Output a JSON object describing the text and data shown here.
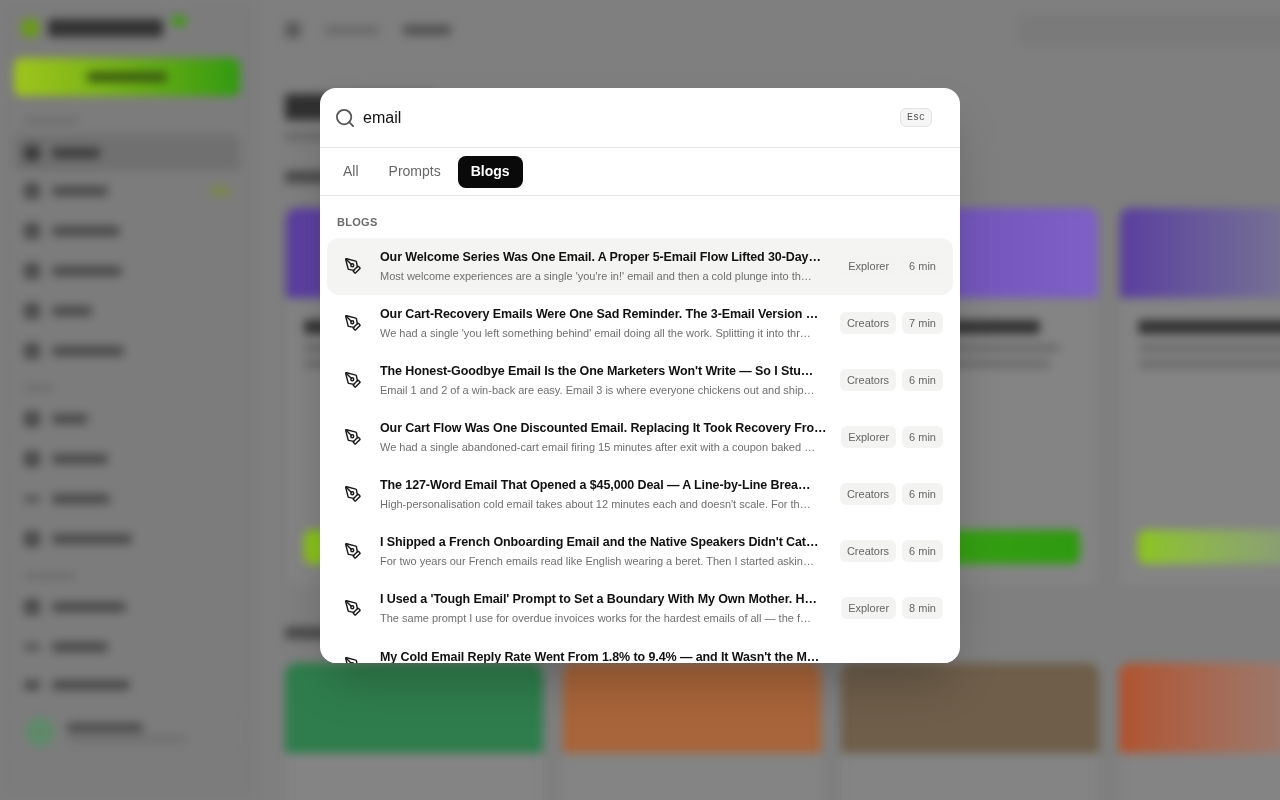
{
  "search": {
    "value": "email",
    "shortcut": "Esc"
  },
  "tabs": [
    {
      "label": "All",
      "selected": false
    },
    {
      "label": "Prompts",
      "selected": false
    },
    {
      "label": "Blogs",
      "selected": true
    }
  ],
  "results": {
    "heading": "BLOGS",
    "items": [
      {
        "title": "Our Welcome Series Was One Email. A Proper 5-Email Flow Lifted 30-Day…",
        "description": "Most welcome experiences are a single 'you're in!' email and then a cold plunge into th…",
        "tag": "Explorer",
        "read_time": "6 min",
        "selected": true
      },
      {
        "title": "Our Cart-Recovery Emails Were One Sad Reminder. The 3-Email Version …",
        "description": "We had a single 'you left something behind' email doing all the work. Splitting it into thr…",
        "tag": "Creators",
        "read_time": "7 min",
        "selected": false
      },
      {
        "title": "The Honest-Goodbye Email Is the One Marketers Won't Write — So I Stu…",
        "description": "Email 1 and 2 of a win-back are easy. Email 3 is where everyone chickens out and ship…",
        "tag": "Creators",
        "read_time": "6 min",
        "selected": false
      },
      {
        "title": "Our Cart Flow Was One Discounted Email. Replacing It Took Recovery Fro…",
        "description": "We had a single abandoned-cart email firing 15 minutes after exit with a coupon baked …",
        "tag": "Explorer",
        "read_time": "6 min",
        "selected": false
      },
      {
        "title": "The 127-Word Email That Opened a $45,000 Deal — A Line-by-Line Brea…",
        "description": "High-personalisation cold email takes about 12 minutes each and doesn't scale. For th…",
        "tag": "Creators",
        "read_time": "6 min",
        "selected": false
      },
      {
        "title": "I Shipped a French Onboarding Email and the Native Speakers Didn't Cat…",
        "description": "For two years our French emails read like English wearing a beret. Then I started askin…",
        "tag": "Creators",
        "read_time": "6 min",
        "selected": false
      },
      {
        "title": "I Used a 'Tough Email' Prompt to Set a Boundary With My Own Mother. H…",
        "description": "The same prompt I use for overdue invoices works for the hardest emails of all — the f…",
        "tag": "Explorer",
        "read_time": "8 min",
        "selected": false
      },
      {
        "title": "My Cold Email Reply Rate Went From 1.8% to 9.4% — and It Wasn't the M…",
        "selected": false
      }
    ]
  }
}
